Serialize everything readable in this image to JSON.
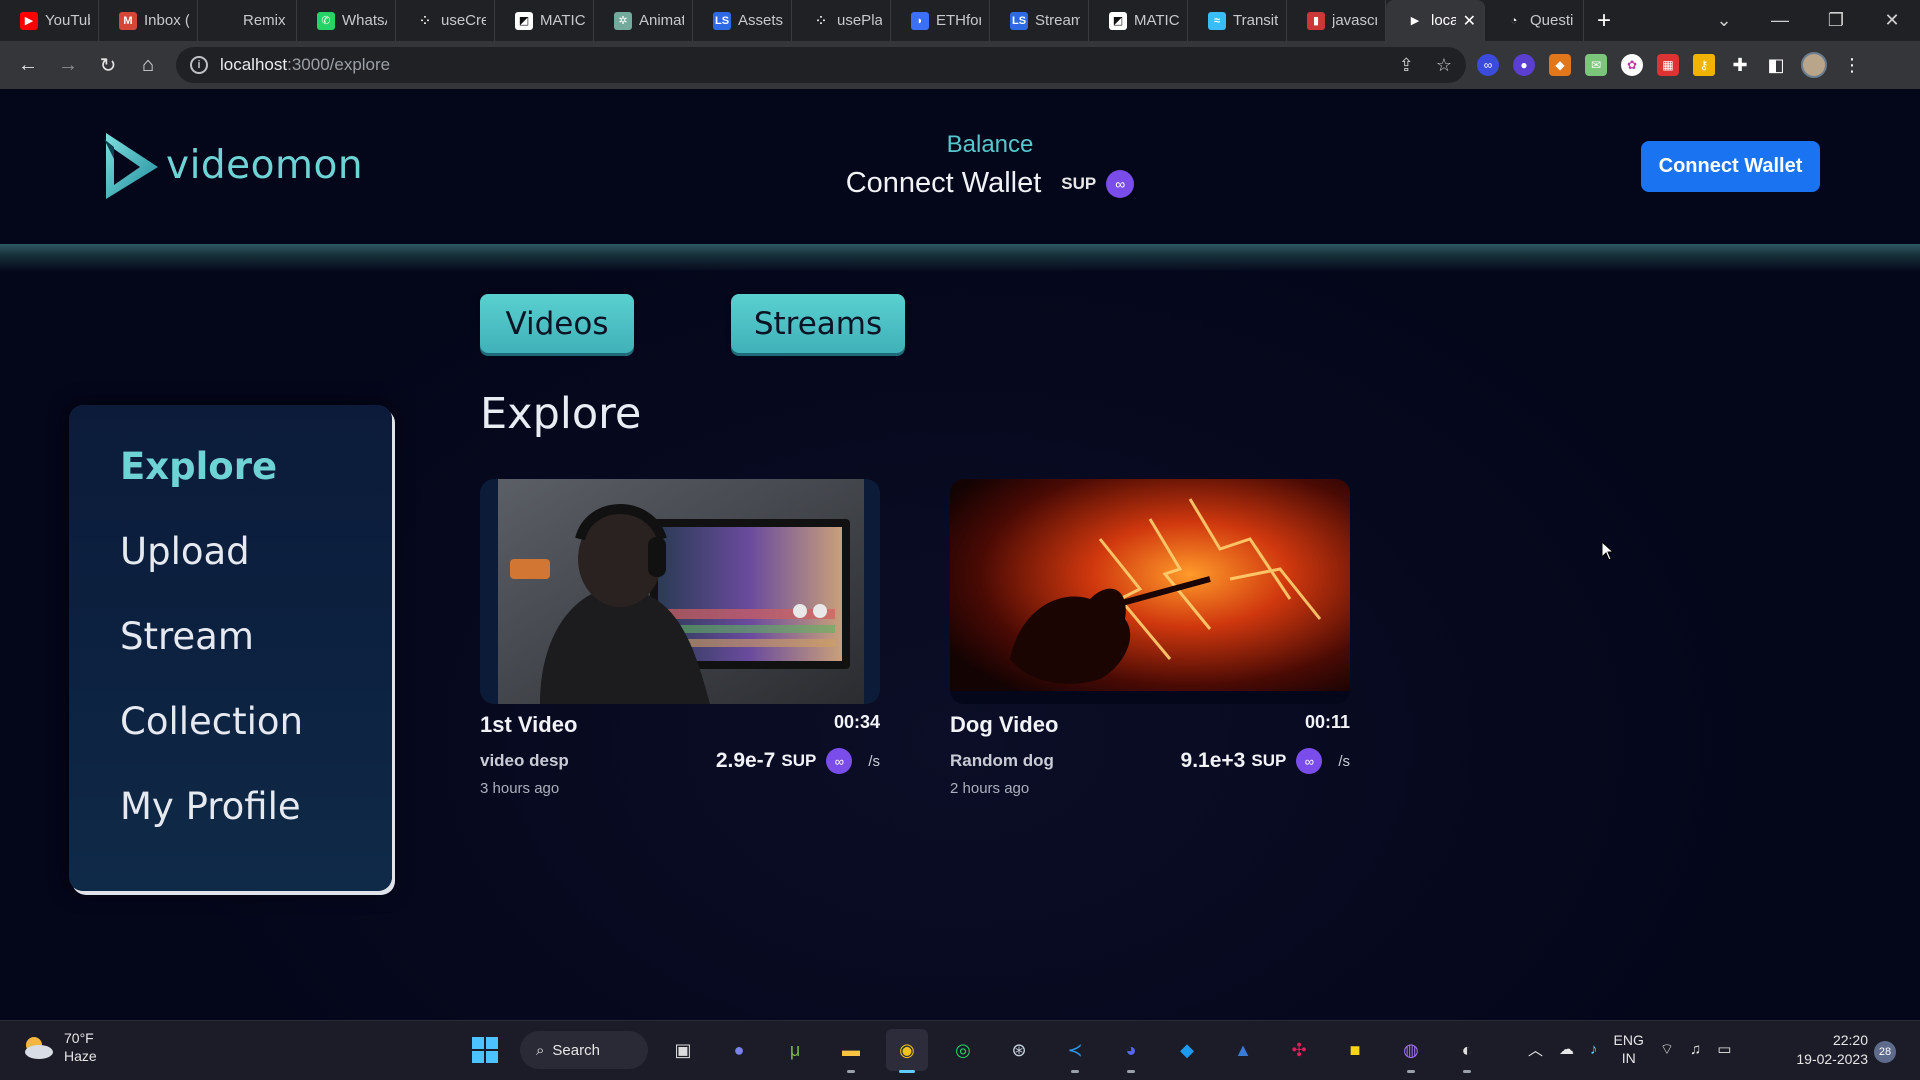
{
  "browser": {
    "tabs": [
      {
        "label": "YouTub",
        "icon": "youtube-icon",
        "color": "#ff0000",
        "glyph": "▶"
      },
      {
        "label": "Inbox (",
        "icon": "gmail-icon",
        "color": "#d44638",
        "glyph": "M"
      },
      {
        "label": "Remix",
        "icon": "remix-icon",
        "color": "#202124",
        "glyph": ""
      },
      {
        "label": "WhatsA",
        "icon": "whatsapp-icon",
        "color": "#25d366",
        "glyph": "✆"
      },
      {
        "label": "useCre",
        "icon": "dots-icon",
        "color": "#202124",
        "glyph": "⁘"
      },
      {
        "label": "MATIC",
        "icon": "matic-icon",
        "color": "#ffffff",
        "glyph": "◩"
      },
      {
        "label": "Animat",
        "icon": "openai-icon",
        "color": "#74aa9c",
        "glyph": "✲"
      },
      {
        "label": "Assets",
        "icon": "ls-icon",
        "color": "#2d6ae3",
        "glyph": "LS"
      },
      {
        "label": "usePlay",
        "icon": "dots-icon",
        "color": "#202124",
        "glyph": "⁘"
      },
      {
        "label": "ETHfor",
        "icon": "eth-icon",
        "color": "#3b6ff5",
        "glyph": "◗"
      },
      {
        "label": "Stream",
        "icon": "ls-icon",
        "color": "#2d6ae3",
        "glyph": "LS"
      },
      {
        "label": "MATIC",
        "icon": "matic-icon",
        "color": "#ffffff",
        "glyph": "◩"
      },
      {
        "label": "Transiti",
        "icon": "tailwind-icon",
        "color": "#38bdf8",
        "glyph": "≈"
      },
      {
        "label": "javascr",
        "icon": "javascript-icon",
        "color": "#cb3837",
        "glyph": "▮"
      },
      {
        "label": "loca",
        "icon": "videomon-icon",
        "color": "#35363a",
        "glyph": "▶",
        "active": true
      },
      {
        "label": "Questi",
        "icon": "question-icon",
        "color": "#202124",
        "glyph": "◔"
      }
    ],
    "url_host": "localhost",
    "url_path": ":3000/explore",
    "new_tab_glyph": "+",
    "close_tab_glyph": "✕"
  },
  "header": {
    "logo_text": "videomon",
    "balance_label": "Balance",
    "balance_value": "Connect Wallet",
    "balance_unit": "SUP",
    "connect_button": "Connect Wallet"
  },
  "tabs": {
    "videos": "Videos",
    "streams": "Streams"
  },
  "page_title": "Explore",
  "sidebar": {
    "items": [
      {
        "label": "Explore",
        "active": true
      },
      {
        "label": "Upload"
      },
      {
        "label": "Stream"
      },
      {
        "label": "Collection"
      },
      {
        "label": "My Profile"
      }
    ]
  },
  "videos": [
    {
      "title": "1st Video",
      "duration": "00:34",
      "description": "video desp",
      "rate": "2.9e-7",
      "unit": "SUP",
      "per": "/s",
      "time": "3 hours ago"
    },
    {
      "title": "Dog Video",
      "duration": "00:11",
      "description": "Random dog",
      "rate": "9.1e+3",
      "unit": "SUP",
      "per": "/s",
      "time": "2 hours ago"
    }
  ],
  "taskbar": {
    "weather_temp": "70°F",
    "weather_desc": "Haze",
    "search_label": "Search",
    "lang_top": "ENG",
    "lang_bottom": "IN",
    "time": "22:20",
    "date": "19-02-2023",
    "notifications": "28"
  },
  "colors": {
    "accent": "#6fd3d6",
    "button_blue": "#1a74f2",
    "coin_purple": "#7a4dea",
    "background": "#04061a"
  }
}
